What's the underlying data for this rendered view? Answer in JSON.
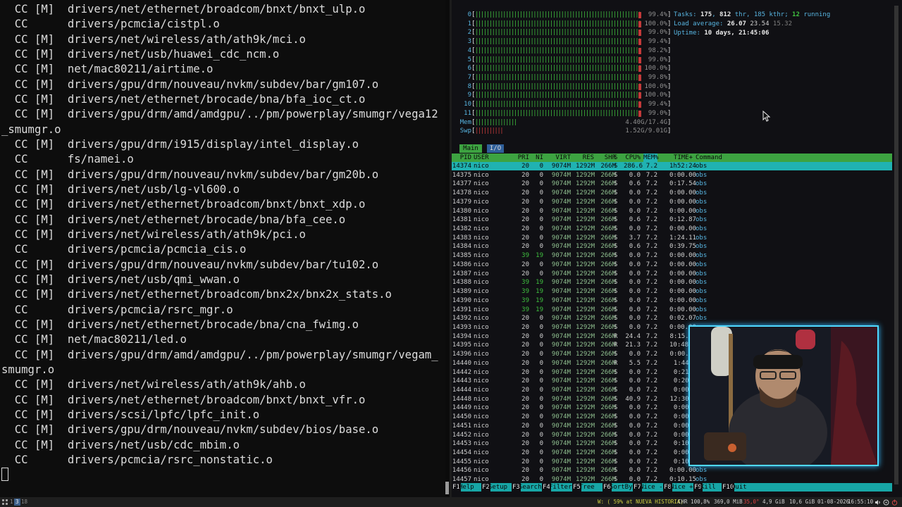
{
  "build_log": [
    "  CC [M]  drivers/net/ethernet/broadcom/bnxt/bnxt_ulp.o",
    "  CC      drivers/pcmcia/cistpl.o",
    "  CC [M]  drivers/net/wireless/ath/ath9k/mci.o",
    "  CC [M]  drivers/net/usb/huawei_cdc_ncm.o",
    "  CC [M]  net/mac80211/airtime.o",
    "  CC [M]  drivers/gpu/drm/nouveau/nvkm/subdev/bar/gm107.o",
    "  CC [M]  drivers/net/ethernet/brocade/bna/bfa_ioc_ct.o",
    "  CC [M]  drivers/gpu/drm/amd/amdgpu/../pm/powerplay/smumgr/vega12",
    "_smumgr.o",
    "  CC [M]  drivers/gpu/drm/i915/display/intel_display.o",
    "  CC      fs/namei.o",
    "  CC [M]  drivers/gpu/drm/nouveau/nvkm/subdev/bar/gm20b.o",
    "  CC [M]  drivers/net/usb/lg-vl600.o",
    "  CC [M]  drivers/net/ethernet/broadcom/bnxt/bnxt_xdp.o",
    "  CC [M]  drivers/net/ethernet/brocade/bna/bfa_cee.o",
    "  CC [M]  drivers/net/wireless/ath/ath9k/pci.o",
    "  CC      drivers/pcmcia/pcmcia_cis.o",
    "  CC [M]  drivers/gpu/drm/nouveau/nvkm/subdev/bar/tu102.o",
    "  CC [M]  drivers/net/usb/qmi_wwan.o",
    "  CC [M]  drivers/net/ethernet/broadcom/bnx2x/bnx2x_stats.o",
    "  CC      drivers/pcmcia/rsrc_mgr.o",
    "  CC [M]  drivers/net/ethernet/brocade/bna/cna_fwimg.o",
    "  CC [M]  net/mac80211/led.o",
    "  CC [M]  drivers/gpu/drm/amd/amdgpu/../pm/powerplay/smumgr/vegam_",
    "smumgr.o",
    "  CC [M]  drivers/net/wireless/ath/ath9k/ahb.o",
    "  CC [M]  drivers/net/ethernet/broadcom/bnxt/bnxt_vfr.o",
    "  CC [M]  drivers/scsi/lpfc/lpfc_init.o",
    "  CC [M]  drivers/gpu/drm/nouveau/nvkm/subdev/bios/base.o",
    "  CC [M]  drivers/net/usb/cdc_mbim.o",
    "  CC      drivers/pcmcia/rsrc_nonstatic.o"
  ],
  "htop": {
    "cpus": [
      {
        "n": "0",
        "val": "99.4%",
        "pct": 99.4
      },
      {
        "n": "1",
        "val": "100.0%",
        "pct": 100
      },
      {
        "n": "2",
        "val": "99.0%",
        "pct": 99.0
      },
      {
        "n": "3",
        "val": "99.4%",
        "pct": 99.4
      },
      {
        "n": "4",
        "val": "98.2%",
        "pct": 98.2
      },
      {
        "n": "5",
        "val": "99.0%",
        "pct": 99.0
      },
      {
        "n": "6",
        "val": "100.0%",
        "pct": 100
      },
      {
        "n": "7",
        "val": "99.8%",
        "pct": 99.8
      },
      {
        "n": "8",
        "val": "100.0%",
        "pct": 100
      },
      {
        "n": "9",
        "val": "100.0%",
        "pct": 100
      },
      {
        "n": "10",
        "val": "99.4%",
        "pct": 99.4
      },
      {
        "n": "11",
        "val": "99.0%",
        "pct": 99.0
      }
    ],
    "mem": {
      "label": "Mem",
      "val": "4.40G/17.4G",
      "pct": 25
    },
    "swp": {
      "label": "Swp",
      "val": "1.52G/9.01G",
      "pct": 17
    },
    "tasks": {
      "label": "Tasks:",
      "count": "175",
      "thr": "812",
      "thr_label": "thr,",
      "kthr": "185 kthr;",
      "running": "12",
      "running_label": "running"
    },
    "load": {
      "label": "Load average:",
      "l1": "26.07",
      "l5": "23.54",
      "l15": "15.32"
    },
    "uptime": {
      "label": "Uptime:",
      "value": "10 days, 21:45:06"
    },
    "tabs": [
      "Main",
      "I/O"
    ],
    "columns": [
      "PID",
      "USER",
      "PRI",
      "NI",
      "VIRT",
      "RES",
      "SHR",
      "S",
      "CPU%",
      "MEM%",
      "TIME+",
      "Command"
    ],
    "processes": [
      {
        "pid": "14374",
        "user": "nico",
        "pri": "20",
        "ni": "0",
        "virt": "9074M",
        "res": "1292M",
        "shr": "266M",
        "s": "S",
        "cpu": "286.6",
        "mem": "7.2",
        "time": "1h52:24",
        "cmd": "obs"
      },
      {
        "pid": "14375",
        "user": "nico",
        "pri": "20",
        "ni": "0",
        "virt": "9074M",
        "res": "1292M",
        "shr": "266M",
        "s": "S",
        "cpu": "0.0",
        "mem": "7.2",
        "time": "0:00.00",
        "cmd": "obs"
      },
      {
        "pid": "14377",
        "user": "nico",
        "pri": "20",
        "ni": "0",
        "virt": "9074M",
        "res": "1292M",
        "shr": "266M",
        "s": "S",
        "cpu": "0.6",
        "mem": "7.2",
        "time": "0:17.54",
        "cmd": "obs"
      },
      {
        "pid": "14378",
        "user": "nico",
        "pri": "20",
        "ni": "0",
        "virt": "9074M",
        "res": "1292M",
        "shr": "266M",
        "s": "S",
        "cpu": "0.0",
        "mem": "7.2",
        "time": "0:00.00",
        "cmd": "obs"
      },
      {
        "pid": "14379",
        "user": "nico",
        "pri": "20",
        "ni": "0",
        "virt": "9074M",
        "res": "1292M",
        "shr": "266M",
        "s": "S",
        "cpu": "0.0",
        "mem": "7.2",
        "time": "0:00.00",
        "cmd": "obs"
      },
      {
        "pid": "14380",
        "user": "nico",
        "pri": "20",
        "ni": "0",
        "virt": "9074M",
        "res": "1292M",
        "shr": "266M",
        "s": "S",
        "cpu": "0.0",
        "mem": "7.2",
        "time": "0:00.00",
        "cmd": "obs"
      },
      {
        "pid": "14381",
        "user": "nico",
        "pri": "20",
        "ni": "0",
        "virt": "9074M",
        "res": "1292M",
        "shr": "266M",
        "s": "S",
        "cpu": "0.6",
        "mem": "7.2",
        "time": "0:12.87",
        "cmd": "obs"
      },
      {
        "pid": "14382",
        "user": "nico",
        "pri": "20",
        "ni": "0",
        "virt": "9074M",
        "res": "1292M",
        "shr": "266M",
        "s": "S",
        "cpu": "0.0",
        "mem": "7.2",
        "time": "0:00.00",
        "cmd": "obs"
      },
      {
        "pid": "14383",
        "user": "nico",
        "pri": "20",
        "ni": "0",
        "virt": "9074M",
        "res": "1292M",
        "shr": "266M",
        "s": "S",
        "cpu": "3.7",
        "mem": "7.2",
        "time": "1:24.11",
        "cmd": "obs"
      },
      {
        "pid": "14384",
        "user": "nico",
        "pri": "20",
        "ni": "0",
        "virt": "9074M",
        "res": "1292M",
        "shr": "266M",
        "s": "S",
        "cpu": "0.6",
        "mem": "7.2",
        "time": "0:39.75",
        "cmd": "obs"
      },
      {
        "pid": "14385",
        "user": "nico",
        "pri": "39",
        "ni": "19",
        "virt": "9074M",
        "res": "1292M",
        "shr": "266M",
        "s": "S",
        "cpu": "0.0",
        "mem": "7.2",
        "time": "0:00.00",
        "cmd": "obs"
      },
      {
        "pid": "14386",
        "user": "nico",
        "pri": "20",
        "ni": "0",
        "virt": "9074M",
        "res": "1292M",
        "shr": "266M",
        "s": "S",
        "cpu": "0.0",
        "mem": "7.2",
        "time": "0:00.00",
        "cmd": "obs"
      },
      {
        "pid": "14387",
        "user": "nico",
        "pri": "20",
        "ni": "0",
        "virt": "9074M",
        "res": "1292M",
        "shr": "266M",
        "s": "S",
        "cpu": "0.0",
        "mem": "7.2",
        "time": "0:00.00",
        "cmd": "obs"
      },
      {
        "pid": "14388",
        "user": "nico",
        "pri": "39",
        "ni": "19",
        "virt": "9074M",
        "res": "1292M",
        "shr": "266M",
        "s": "S",
        "cpu": "0.0",
        "mem": "7.2",
        "time": "0:00.00",
        "cmd": "obs"
      },
      {
        "pid": "14389",
        "user": "nico",
        "pri": "39",
        "ni": "19",
        "virt": "9074M",
        "res": "1292M",
        "shr": "266M",
        "s": "S",
        "cpu": "0.0",
        "mem": "7.2",
        "time": "0:00.00",
        "cmd": "obs"
      },
      {
        "pid": "14390",
        "user": "nico",
        "pri": "39",
        "ni": "19",
        "virt": "9074M",
        "res": "1292M",
        "shr": "266M",
        "s": "S",
        "cpu": "0.0",
        "mem": "7.2",
        "time": "0:00.00",
        "cmd": "obs"
      },
      {
        "pid": "14391",
        "user": "nico",
        "pri": "39",
        "ni": "19",
        "virt": "9074M",
        "res": "1292M",
        "shr": "266M",
        "s": "S",
        "cpu": "0.0",
        "mem": "7.2",
        "time": "0:00.00",
        "cmd": "obs"
      },
      {
        "pid": "14392",
        "user": "nico",
        "pri": "20",
        "ni": "0",
        "virt": "9074M",
        "res": "1292M",
        "shr": "266M",
        "s": "S",
        "cpu": "0.0",
        "mem": "7.2",
        "time": "0:02.07",
        "cmd": "obs"
      },
      {
        "pid": "14393",
        "user": "nico",
        "pri": "20",
        "ni": "0",
        "virt": "9074M",
        "res": "1292M",
        "shr": "266M",
        "s": "S",
        "cpu": "0.0",
        "mem": "7.2",
        "time": "0:00.00",
        "cmd": ""
      },
      {
        "pid": "14394",
        "user": "nico",
        "pri": "20",
        "ni": "0",
        "virt": "9074M",
        "res": "1292M",
        "shr": "266M",
        "s": "R",
        "cpu": "24.4",
        "mem": "7.2",
        "time": "8:15.0",
        "cmd": ""
      },
      {
        "pid": "14395",
        "user": "nico",
        "pri": "20",
        "ni": "0",
        "virt": "9074M",
        "res": "1292M",
        "shr": "266M",
        "s": "R",
        "cpu": "21.3",
        "mem": "7.2",
        "time": "10:48.4",
        "cmd": ""
      },
      {
        "pid": "14396",
        "user": "nico",
        "pri": "20",
        "ni": "0",
        "virt": "9074M",
        "res": "1292M",
        "shr": "266M",
        "s": "S",
        "cpu": "0.0",
        "mem": "7.2",
        "time": "0:00.0",
        "cmd": ""
      },
      {
        "pid": "14440",
        "user": "nico",
        "pri": "20",
        "ni": "0",
        "virt": "9074M",
        "res": "1292M",
        "shr": "266M",
        "s": "R",
        "cpu": "5.5",
        "mem": "7.2",
        "time": "1:44.",
        "cmd": ""
      },
      {
        "pid": "14442",
        "user": "nico",
        "pri": "20",
        "ni": "0",
        "virt": "9074M",
        "res": "1292M",
        "shr": "266M",
        "s": "S",
        "cpu": "0.0",
        "mem": "7.2",
        "time": "0:21.",
        "cmd": ""
      },
      {
        "pid": "14443",
        "user": "nico",
        "pri": "20",
        "ni": "0",
        "virt": "9074M",
        "res": "1292M",
        "shr": "266M",
        "s": "S",
        "cpu": "0.0",
        "mem": "7.2",
        "time": "0:20.",
        "cmd": ""
      },
      {
        "pid": "14444",
        "user": "nico",
        "pri": "20",
        "ni": "0",
        "virt": "9074M",
        "res": "1292M",
        "shr": "266M",
        "s": "S",
        "cpu": "0.0",
        "mem": "7.2",
        "time": "0:00.",
        "cmd": ""
      },
      {
        "pid": "14448",
        "user": "nico",
        "pri": "20",
        "ni": "0",
        "virt": "9074M",
        "res": "1292M",
        "shr": "266M",
        "s": "S",
        "cpu": "40.9",
        "mem": "7.2",
        "time": "12:30.",
        "cmd": ""
      },
      {
        "pid": "14449",
        "user": "nico",
        "pri": "20",
        "ni": "0",
        "virt": "9074M",
        "res": "1292M",
        "shr": "266M",
        "s": "S",
        "cpu": "0.0",
        "mem": "7.2",
        "time": "0:00.",
        "cmd": ""
      },
      {
        "pid": "14450",
        "user": "nico",
        "pri": "20",
        "ni": "0",
        "virt": "9074M",
        "res": "1292M",
        "shr": "266M",
        "s": "S",
        "cpu": "0.0",
        "mem": "7.2",
        "time": "0:00.",
        "cmd": ""
      },
      {
        "pid": "14451",
        "user": "nico",
        "pri": "20",
        "ni": "0",
        "virt": "9074M",
        "res": "1292M",
        "shr": "266M",
        "s": "S",
        "cpu": "0.0",
        "mem": "7.2",
        "time": "0:00.",
        "cmd": ""
      },
      {
        "pid": "14452",
        "user": "nico",
        "pri": "20",
        "ni": "0",
        "virt": "9074M",
        "res": "1292M",
        "shr": "266M",
        "s": "S",
        "cpu": "0.0",
        "mem": "7.2",
        "time": "0:00.",
        "cmd": ""
      },
      {
        "pid": "14453",
        "user": "nico",
        "pri": "20",
        "ni": "0",
        "virt": "9074M",
        "res": "1292M",
        "shr": "266M",
        "s": "S",
        "cpu": "0.0",
        "mem": "7.2",
        "time": "0:10.",
        "cmd": ""
      },
      {
        "pid": "14454",
        "user": "nico",
        "pri": "20",
        "ni": "0",
        "virt": "9074M",
        "res": "1292M",
        "shr": "266M",
        "s": "S",
        "cpu": "0.0",
        "mem": "7.2",
        "time": "0:00.",
        "cmd": ""
      },
      {
        "pid": "14455",
        "user": "nico",
        "pri": "20",
        "ni": "0",
        "virt": "9074M",
        "res": "1292M",
        "shr": "266M",
        "s": "S",
        "cpu": "0.0",
        "mem": "7.2",
        "time": "0:10.",
        "cmd": ""
      },
      {
        "pid": "14456",
        "user": "nico",
        "pri": "20",
        "ni": "0",
        "virt": "9074M",
        "res": "1292M",
        "shr": "266M",
        "s": "S",
        "cpu": "0.0",
        "mem": "7.2",
        "time": "0:00.00",
        "cmd": "obs"
      },
      {
        "pid": "14457",
        "user": "nico",
        "pri": "20",
        "ni": "0",
        "virt": "9074M",
        "res": "1292M",
        "shr": "266M",
        "s": "S",
        "cpu": "0.0",
        "mem": "7.2",
        "time": "0:10.15",
        "cmd": "obs"
      }
    ],
    "fkeys": [
      {
        "key": "F1",
        "label": "Help"
      },
      {
        "key": "F2",
        "label": "Setup"
      },
      {
        "key": "F3",
        "label": "Search"
      },
      {
        "key": "F4",
        "label": "Filter"
      },
      {
        "key": "F5",
        "label": "Tree"
      },
      {
        "key": "F6",
        "label": "SortBy"
      },
      {
        "key": "F7",
        "label": "Nice -"
      },
      {
        "key": "F8",
        "label": "Nice +"
      },
      {
        "key": "F9",
        "label": "Kill"
      },
      {
        "key": "F10",
        "label": "Quit"
      }
    ]
  },
  "statusbar": {
    "workspaces": [
      "1",
      "3",
      "18"
    ],
    "active_workspace": "3",
    "items": {
      "playing": "W: ( 59% at NUEVA HISTORIA)",
      "chr": "CHR 100,8%",
      "mib": "369,0 MiB",
      "temp": "35,0°",
      "mem": "4,9 GiB",
      "disk": "10,6 GiB",
      "date": "01-08-2026",
      "time": "16:55:10"
    }
  },
  "colors": {
    "accent_green": "#3da341",
    "selected_cyan": "#20b2b2",
    "cpu_blue": "#57b4e0",
    "webcam_border": "#4fd9ff"
  }
}
